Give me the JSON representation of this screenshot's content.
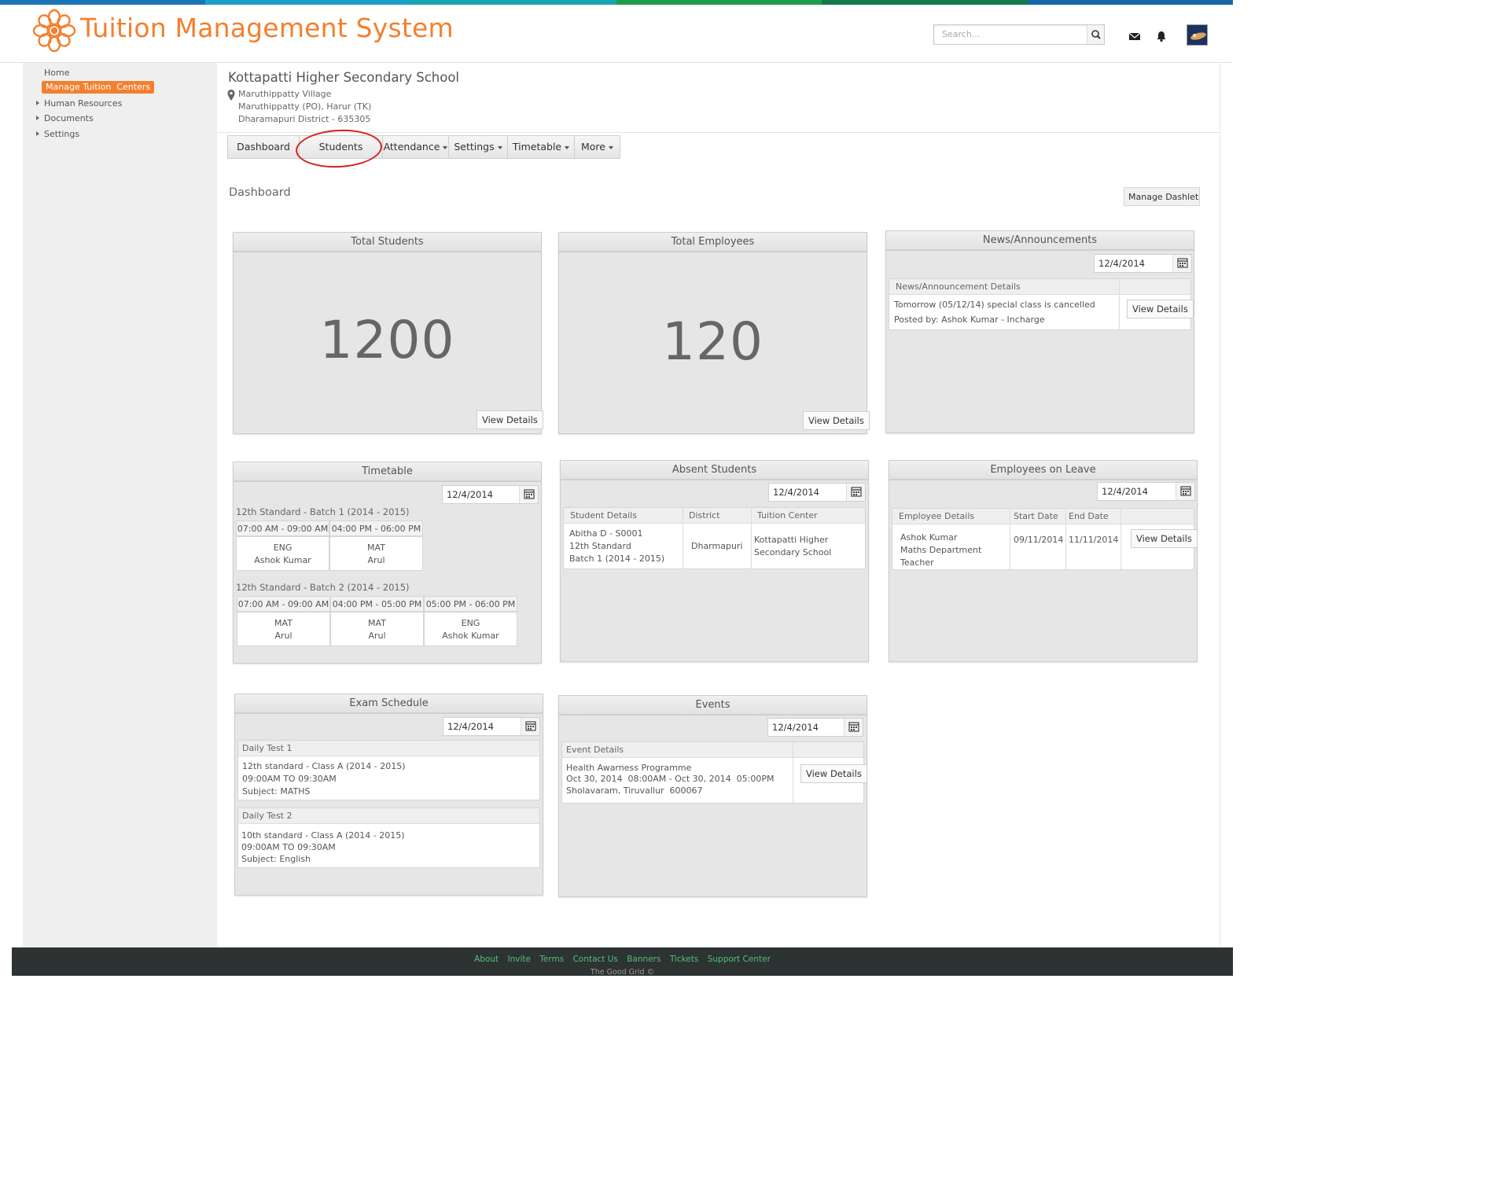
{
  "colors": {
    "brand": "#f47f2e",
    "active_nav": "#f47f2e",
    "footer_link": "#4fc07a",
    "footer_bg": "#2d3232",
    "highlight_circle": "#d62020"
  },
  "app": {
    "title": "Tuition Management System"
  },
  "search": {
    "placeholder": "Search..."
  },
  "header_icons": [
    "search-icon",
    "mail-icon",
    "bell-icon",
    "avatar"
  ],
  "sidebar": {
    "items": [
      {
        "label": "Home"
      },
      {
        "label": "Manage Tuition  Centers",
        "active": true
      },
      {
        "label": "Human Resources"
      },
      {
        "label": "Documents"
      },
      {
        "label": "Settings"
      }
    ]
  },
  "school": {
    "name": "Kottapatti Higher Secondary School",
    "address": [
      "Maruthippatty Village",
      "Maruthippatty (PO), Harur (TK)",
      "Dharamapuri District - 635305"
    ]
  },
  "tabs": [
    {
      "label": "Dashboard"
    },
    {
      "label": "Students"
    },
    {
      "label": "Attendance"
    },
    {
      "label": "Settings"
    },
    {
      "label": "Timetable"
    },
    {
      "label": "More"
    }
  ],
  "dashboard": {
    "title": "Dashboard",
    "manage_label": "Manage Dashlets",
    "view_details": "View Details",
    "total_students": {
      "title": "Total Students",
      "value": "1200"
    },
    "total_employees": {
      "title": "Total Employees",
      "value": "120"
    },
    "news": {
      "title": "News/Announcements",
      "date": "12/4/2014",
      "column": "News/Announcement Details",
      "text": "Tomorrow (05/12/14) special class is cancelled",
      "posted": "Posted by: Ashok Kumar - Incharge"
    },
    "timetable": {
      "title": "Timetable",
      "date": "12/4/2014",
      "batches": [
        {
          "name": "12th Standard - Batch 1 (2014 - 2015)",
          "slots": [
            {
              "time": "07:00 AM - 09:00 AM",
              "subject": "ENG",
              "teacher": "Ashok Kumar"
            },
            {
              "time": "04:00 PM - 06:00 PM",
              "subject": "MAT",
              "teacher": "Arul"
            }
          ]
        },
        {
          "name": "12th Standard - Batch 2 (2014 - 2015)",
          "slots": [
            {
              "time": "07:00 AM - 09:00 AM",
              "subject": "MAT",
              "teacher": "Arul"
            },
            {
              "time": "04:00 PM - 05:00 PM",
              "subject": "MAT",
              "teacher": "Arul"
            },
            {
              "time": "05:00 PM - 06:00 PM",
              "subject": "ENG",
              "teacher": "Ashok Kumar"
            }
          ]
        }
      ]
    },
    "absent": {
      "title": "Absent Students",
      "date": "12/4/2014",
      "columns": [
        "Student Details",
        "District",
        "Tuition Center"
      ],
      "row": {
        "student": [
          "Abitha D - S0001",
          "12th Standard",
          "Batch 1 (2014 - 2015)"
        ],
        "district": "Dharmapuri",
        "center": [
          "Kottapatti Higher",
          "Secondary School"
        ]
      }
    },
    "leave": {
      "title": "Employees on Leave",
      "date": "12/4/2014",
      "columns": [
        "Employee Details",
        "Start Date",
        "End Date"
      ],
      "row": {
        "employee": [
          "Ashok Kumar",
          "Maths Department",
          "Teacher"
        ],
        "start": "09/11/2014",
        "end": "11/11/2014"
      }
    },
    "exams": {
      "title": "Exam Schedule",
      "date": "12/4/2014",
      "items": [
        {
          "name": "Daily Test 1",
          "lines": [
            "12th standard - Class A (2014 - 2015)",
            "09:00AM  TO  09:30AM",
            "Subject: MATHS"
          ]
        },
        {
          "name": "Daily Test 2",
          "lines": [
            "10th standard - Class A (2014 - 2015)",
            "09:00AM  TO  09:30AM",
            "Subject: English"
          ]
        }
      ]
    },
    "events": {
      "title": "Events",
      "date": "12/4/2014",
      "column": "Event Details",
      "lines": [
        "Health Awarness Programme",
        "Oct 30, 2014  08:00AM - Oct 30, 2014  05:00PM",
        "Sholavaram, Tiruvallur  600067"
      ]
    }
  },
  "footer": {
    "links": [
      "About",
      "Invite",
      "Terms",
      "Contact Us",
      "Banners",
      "Tickets",
      "Support Center"
    ],
    "copyright": "The Good Grid ©"
  }
}
